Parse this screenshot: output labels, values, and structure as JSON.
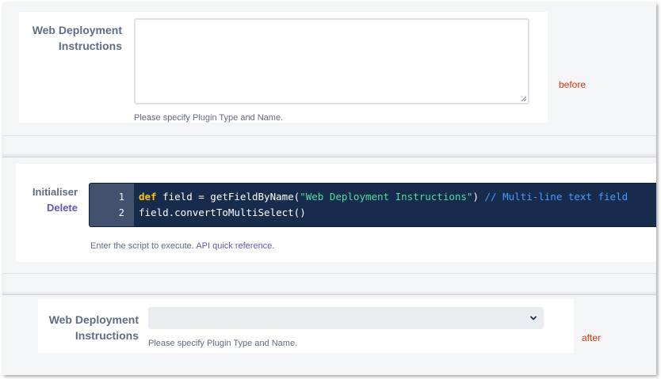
{
  "before_panel": {
    "label": "Web Deployment Instructions",
    "textarea_value": "",
    "help": "Please specify Plugin Type and Name."
  },
  "annotations": {
    "before": "before",
    "after": "after"
  },
  "initialiser_panel": {
    "label": "Initialiser",
    "delete_label": "Delete",
    "code_lines": [
      {
        "num": "1",
        "keyword": "def",
        "part_a": " field = getFieldByName(",
        "string": "\"Web Deployment Instructions\"",
        "part_b": ") ",
        "comment": "// Multi-line text field"
      },
      {
        "num": "2",
        "text": "field.convertToMultiSelect()"
      }
    ],
    "help_text": "Enter the script to execute.",
    "help_link": "API quick reference."
  },
  "after_panel": {
    "label": "Web Deployment Instructions",
    "select_value": "",
    "help": "Please specify Plugin Type and Name."
  },
  "colors": {
    "label": "#5e6c84",
    "link": "#6554c0",
    "annotation": "#de350b",
    "editor_bg": "#172b4d",
    "gutter_bg": "#42526e",
    "keyword": "#ffc400",
    "string": "#57d9a3",
    "comment": "#4c9aff"
  }
}
